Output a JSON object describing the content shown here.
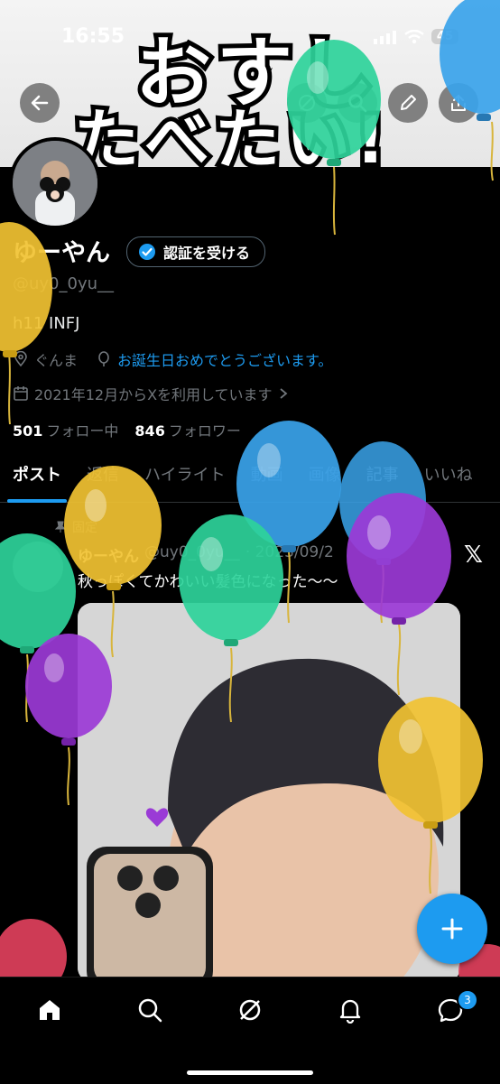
{
  "status_bar": {
    "time": "16:55",
    "battery": "45"
  },
  "header": {
    "line1": "おすし",
    "line2": "たべたい!"
  },
  "profile": {
    "name": "ゆーやん",
    "verify_label": "認証を受ける",
    "handle": "@uy0_0yu__",
    "bio": "h11 INFJ",
    "location": "ぐんま",
    "birthday": "お誕生日おめでとうございます。",
    "joined": "2021年12月からXを利用しています",
    "following_count": "501",
    "following_label": "フォロー中",
    "followers_count": "846",
    "followers_label": "フォロワー"
  },
  "tabs": [
    {
      "label": "ポスト"
    },
    {
      "label": "返信"
    },
    {
      "label": "ハイライト"
    },
    {
      "label": "動画"
    },
    {
      "label": "画像"
    },
    {
      "label": "記事"
    },
    {
      "label": "いいね"
    }
  ],
  "post": {
    "pinned_label": "固定",
    "author_name": "ゆーやん",
    "author_handle": "@uy0_0yu__",
    "date": "· 2023/09/2",
    "text": "秋っぽくてかわいい髪色になった〜〜",
    "x_logo": "𝕏"
  },
  "bottom_nav": {
    "messages_badge": "3"
  },
  "colors": {
    "accent": "#1d9bf0",
    "background": "#000000"
  },
  "icons": [
    "back-icon",
    "search-icon",
    "edit-icon",
    "share-icon",
    "verified-icon",
    "location-icon",
    "birthday-icon",
    "calendar-icon",
    "pin-icon",
    "plus-icon",
    "home-icon",
    "grok-icon",
    "bell-icon",
    "messages-icon"
  ]
}
